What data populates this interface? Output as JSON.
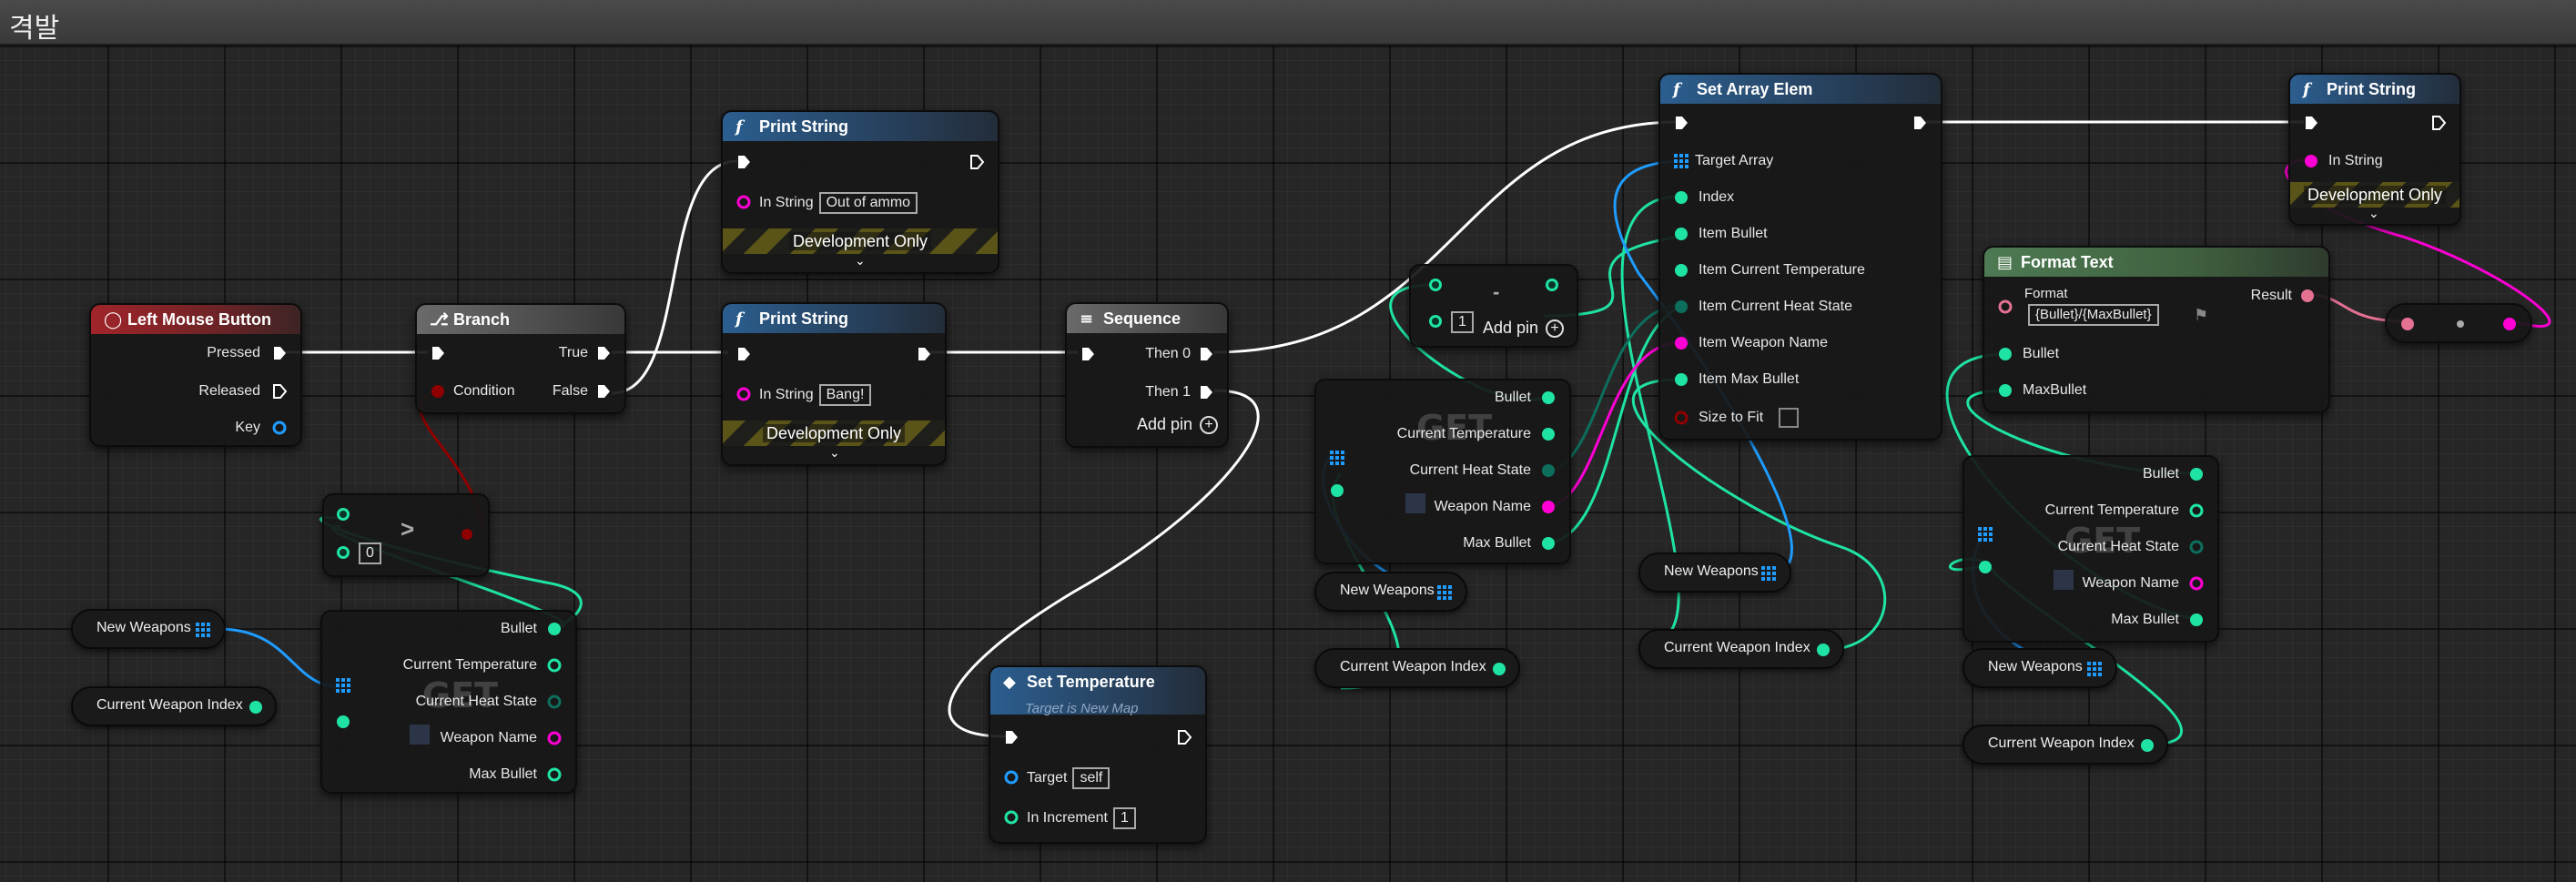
{
  "window": {
    "title": "격발"
  },
  "nodes": {
    "left_mouse": {
      "title": "Left Mouse Button",
      "pressed": "Pressed",
      "released": "Released",
      "key": "Key"
    },
    "branch": {
      "title": "Branch",
      "condition": "Condition",
      "true": "True",
      "false": "False"
    },
    "print_ammo": {
      "title": "Print String",
      "in_string": "In String",
      "value": "Out of ammo",
      "dev": "Development Only"
    },
    "print_bang": {
      "title": "Print String",
      "in_string": "In String",
      "value": "Bang!",
      "dev": "Development Only"
    },
    "sequence": {
      "title": "Sequence",
      "then0": "Then 0",
      "then1": "Then 1",
      "add_pin": "Add pin"
    },
    "greater": {
      "symbol": ">",
      "value": "0"
    },
    "set_temp": {
      "title": "Set Temperature",
      "subtitle": "Target is New Map",
      "target": "Target",
      "target_value": "self",
      "increment": "In Increment",
      "increment_value": "1"
    },
    "minus": {
      "symbol": "-",
      "value": "1",
      "add_pin": "Add pin"
    },
    "set_array": {
      "title": "Set Array Elem",
      "target_array": "Target Array",
      "index": "Index",
      "item_bullet": "Item Bullet",
      "item_temp": "Item Current Temperature",
      "item_heat": "Item Current Heat State",
      "item_name": "Item Weapon Name",
      "item_max": "Item Max Bullet",
      "size_to_fit": "Size to Fit"
    },
    "print_end": {
      "title": "Print String",
      "in_string": "In String",
      "dev": "Development Only"
    },
    "format_text": {
      "title": "Format Text",
      "format": "Format",
      "format_value": "{Bullet}/{MaxBullet}",
      "result": "Result",
      "bullet": "Bullet",
      "max_bullet": "MaxBullet"
    }
  },
  "get_struct": {
    "watermark": "GET",
    "bullet": "Bullet",
    "temp": "Current Temperature",
    "heat": "Current Heat State",
    "name": "Weapon Name",
    "max": "Max Bullet"
  },
  "variables": {
    "new_weapons": "New Weapons",
    "current_weapon_index": "Current Weapon Index"
  },
  "colors": {
    "exec": "#ffffff",
    "int": "#1fe3a5",
    "bool": "#8f0000",
    "string": "#ff00d4",
    "object": "#1f9cff",
    "enum": "#0d6e5c",
    "text": "#e47092"
  }
}
